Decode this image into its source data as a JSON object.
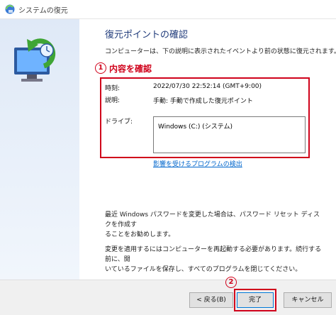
{
  "window": {
    "title": "システムの復元"
  },
  "page": {
    "heading": "復元ポイントの確認",
    "subtext": "コンピューターは、下の説明に表示されたイベントより前の状態に復元されます。"
  },
  "annotations": {
    "step1_number": "1",
    "step1_label": "内容を確認",
    "step2_number": "2"
  },
  "details": {
    "time_label": "時刻:",
    "time_value": "2022/07/30 22:52:14 (GMT+9:00)",
    "desc_label": "説明:",
    "desc_value": "手動: 手動で作成した復元ポイント",
    "drive_label": "ドライブ:",
    "drive_value": "Windows (C:) (システム)"
  },
  "links": {
    "affected_programs": "影響を受けるプログラムの検出"
  },
  "notes": {
    "password_line1": "最近 Windows パスワードを変更した場合は、パスワード リセット ディスクを作成す",
    "password_line2": "ることをお勧めします。",
    "restart_line1": "変更を適用するにはコンピューターを再起動する必要があります。続行する前に、開",
    "restart_line2": "いているファイルを保存し、すべてのプログラムを閉じてください。"
  },
  "buttons": {
    "back": "< 戻る(B)",
    "finish": "完了",
    "cancel": "キャンセル"
  },
  "colors": {
    "annotation": "#d0021b",
    "heading": "#1f3a7a",
    "link": "#0066cc"
  }
}
